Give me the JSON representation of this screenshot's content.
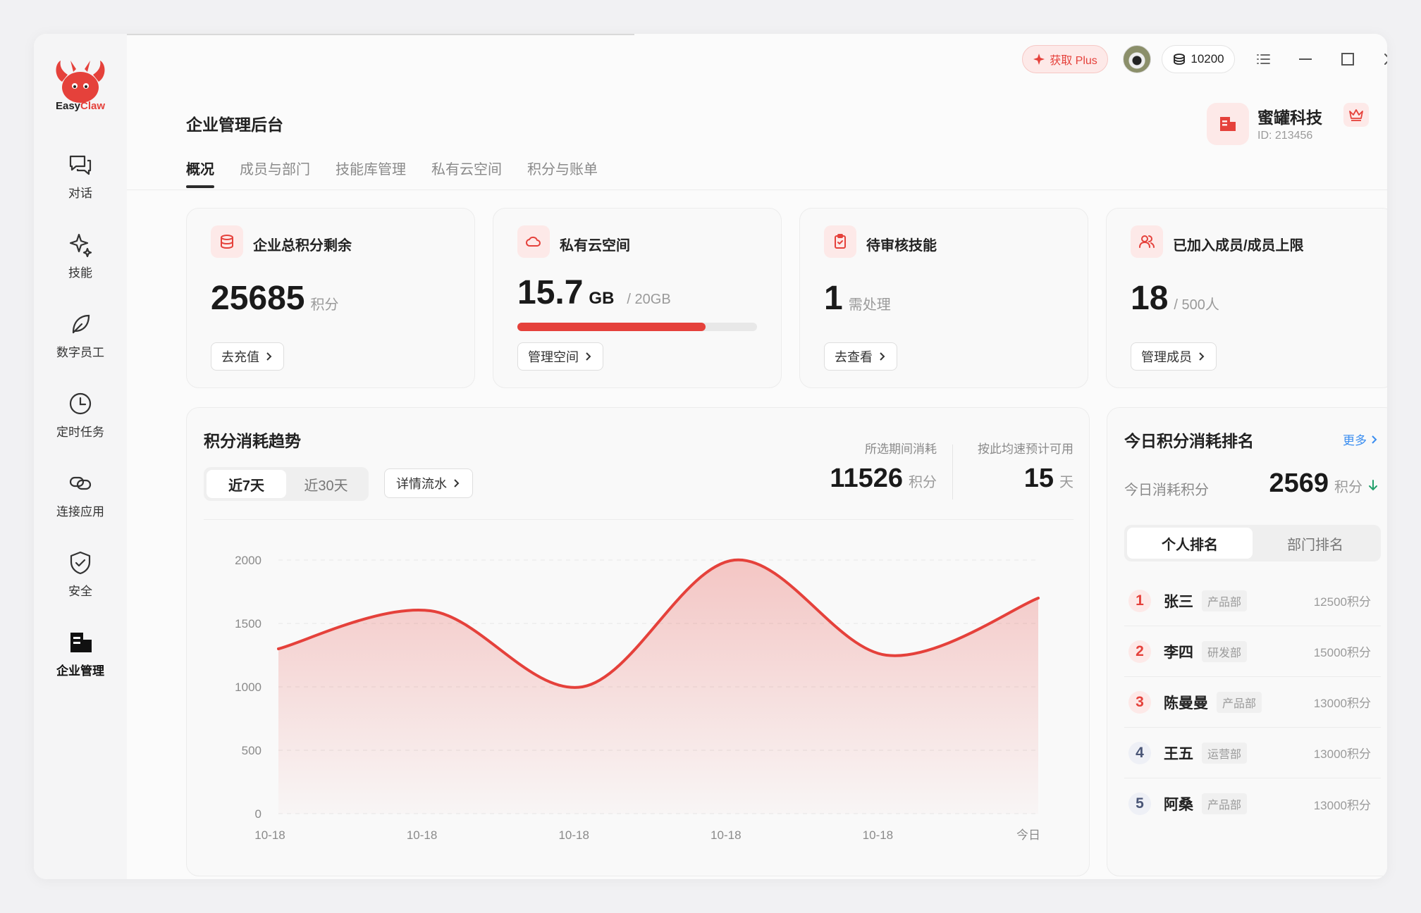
{
  "brand": {
    "part1": "Easy",
    "part2": "Claw"
  },
  "sidebar": {
    "items": [
      {
        "label": "对话",
        "icon": "chat-icon"
      },
      {
        "label": "技能",
        "icon": "sparkle-icon"
      },
      {
        "label": "数字员工",
        "icon": "leaf-icon"
      },
      {
        "label": "定时任务",
        "icon": "clock-icon"
      },
      {
        "label": "连接应用",
        "icon": "link-icon"
      },
      {
        "label": "安全",
        "icon": "shield-icon"
      },
      {
        "label": "企业管理",
        "icon": "building-icon",
        "active": true
      }
    ]
  },
  "topbar": {
    "plus_label": "获取 Plus",
    "points": "10200"
  },
  "page": {
    "title": "企业管理后台",
    "tabs": [
      "概况",
      "成员与部门",
      "技能库管理",
      "私有云空间",
      "积分与账单"
    ],
    "active_tab": 0
  },
  "company": {
    "name": "蜜罐科技",
    "id": "ID: 213456"
  },
  "stats": [
    {
      "title": "企业总积分剩余",
      "value": "25685",
      "unit": "积分",
      "button": "去充值",
      "icon": "database-icon"
    },
    {
      "title": "私有云空间",
      "value": "15.7",
      "unit_strong": "GB",
      "unit": "/ 20GB",
      "progress": 0.785,
      "button": "管理空间",
      "icon": "cloud-icon"
    },
    {
      "title": "待审核技能",
      "value": "1",
      "unit": "需处理",
      "button": "去查看",
      "icon": "clipboard-check-icon"
    },
    {
      "title": "已加入成员/成员上限",
      "value": "18",
      "unit": "/ 500人",
      "button": "管理成员",
      "icon": "users-icon"
    }
  ],
  "trend": {
    "title": "积分消耗趋势",
    "ranges": [
      "近7天",
      "近30天"
    ],
    "active_range": 0,
    "detail_button": "详情流水",
    "period_label": "所选期间消耗",
    "period_value": "11526",
    "period_unit": "积分",
    "forecast_label": "按此均速预计可用",
    "forecast_value": "15",
    "forecast_unit": "天"
  },
  "chart_data": {
    "type": "area",
    "x": [
      "10-18",
      "10-18",
      "10-18",
      "10-18",
      "10-18",
      "今日"
    ],
    "series": [
      {
        "values": [
          1300,
          1600,
          1000,
          2000,
          1250,
          1700
        ]
      }
    ],
    "ylim": [
      0,
      2000
    ],
    "yticks": [
      0,
      500,
      1000,
      1500,
      2000
    ],
    "grid": true,
    "color": "#e5413b"
  },
  "ranking": {
    "title": "今日积分消耗排名",
    "more": "更多",
    "today_label": "今日消耗积分",
    "today_value": "2569",
    "today_unit": "积分",
    "trend_color": "#22a06b",
    "tabs": [
      "个人排名",
      "部门排名"
    ],
    "active_tab": 0,
    "rows": [
      {
        "rank": "1",
        "name": "张三",
        "dept": "产品部",
        "score": "12500积分"
      },
      {
        "rank": "2",
        "name": "李四",
        "dept": "研发部",
        "score": "15000积分"
      },
      {
        "rank": "3",
        "name": "陈曼曼",
        "dept": "产品部",
        "score": "13000积分"
      },
      {
        "rank": "4",
        "name": "王五",
        "dept": "运营部",
        "score": "13000积分"
      },
      {
        "rank": "5",
        "name": "阿桑",
        "dept": "产品部",
        "score": "13000积分"
      }
    ]
  },
  "colors": {
    "accent": "#e5413b",
    "accent_soft": "#fde9e8",
    "link": "#3b8ef0"
  }
}
